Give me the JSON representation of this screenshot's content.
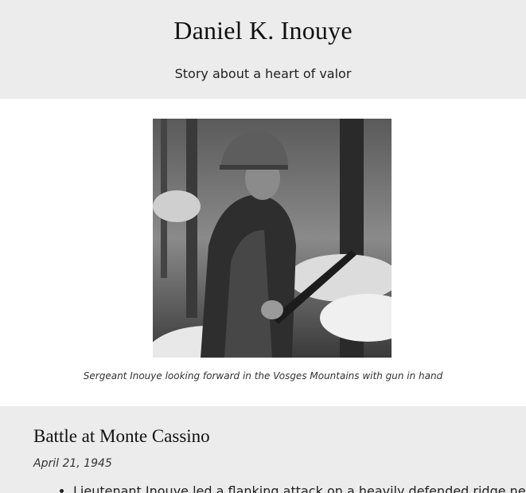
{
  "header": {
    "title": "Daniel K. Inouye",
    "subtitle": "Story about a heart of valor"
  },
  "figure": {
    "caption": "Sergeant Inouye looking forward in the Vosges Mountains with gun in hand"
  },
  "section": {
    "heading": "Battle at Monte Cassino",
    "date": "April 21, 1945",
    "items": [
      "Lieutenant Inouye led a flanking attack on a heavily defended ridge near"
    ]
  }
}
